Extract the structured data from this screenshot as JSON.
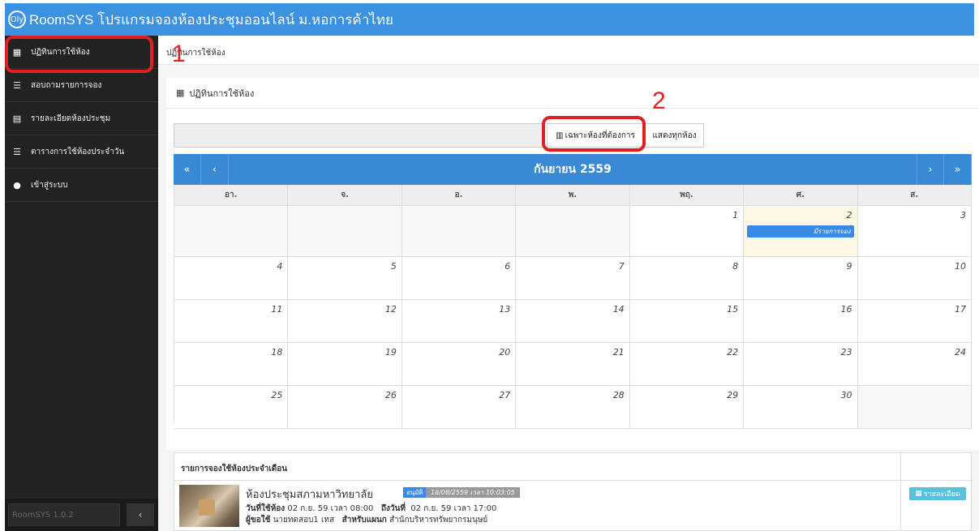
{
  "app": {
    "logo_text": "Oly",
    "title": "RoomSYS โปรแกรมจองห้องประชุมออนไลน์ ม.หอการค้าไทย"
  },
  "sidebar": {
    "items": [
      {
        "label": "ปฏิทินการใช้ห้อง",
        "icon": "calendar-icon"
      },
      {
        "label": "สอบถามรายการจอง",
        "icon": "list-icon"
      },
      {
        "label": "รายละเอียดห้องประชุม",
        "icon": "document-icon"
      },
      {
        "label": "ตารางการใช้ห้องประจำวัน",
        "icon": "list-icon"
      },
      {
        "label": "เข้าสู่ระบบ",
        "icon": "user-icon"
      }
    ],
    "version": "RoomSYS 1.0.2",
    "collapse_label": "‹"
  },
  "annotations": {
    "one": "1",
    "two": "2"
  },
  "breadcrumb": "ปฏิทินการใช้ห้อง",
  "panel": {
    "title": "ปฏิทินการใช้ห้อง"
  },
  "filter": {
    "only_label": "เฉพาะห้องที่ต้องการ",
    "all_label": "แสดงทุกห้อง"
  },
  "calendar": {
    "month_title": "กันยายน 2559",
    "first_label": "«",
    "prev_label": "‹",
    "next_label": "›",
    "last_label": "»",
    "days_of_week": [
      "อา.",
      "จ.",
      "อ.",
      "พ.",
      "พฤ.",
      "ศ.",
      "ส."
    ],
    "weeks": [
      [
        "",
        "",
        "",
        "",
        "1",
        "2",
        "3"
      ],
      [
        "4",
        "5",
        "6",
        "7",
        "8",
        "9",
        "10"
      ],
      [
        "11",
        "12",
        "13",
        "14",
        "15",
        "16",
        "17"
      ],
      [
        "18",
        "19",
        "20",
        "21",
        "22",
        "23",
        "24"
      ],
      [
        "25",
        "26",
        "27",
        "28",
        "29",
        "30",
        ""
      ]
    ],
    "event_label": "มีรายการจอง"
  },
  "booking_list": {
    "title": "รายการจองใช้ห้องประจำเดือน",
    "room_name": "ห้องประชุมสภามหาวิทยาลัย",
    "status": "อนุมัติ",
    "timestamp": "18/08/2559 เวลา 10:03:05",
    "use_date_label": "วันที่ใช้ห้อง",
    "use_date_value": "02 ก.ย. 59 เวลา 08:00",
    "to_date_label": "ถึงวันที่",
    "to_date_value": "02 ก.ย. 59 เวลา 17:00",
    "user_label": "ผู้ขอใช้",
    "user_value": "นายทดสอบ1 เทส",
    "dept_label": "สำหรับแผนก",
    "dept_value": "สำนักบริหารทรัพยากรมนุษย์",
    "detail_label": "รายละเอียด"
  }
}
